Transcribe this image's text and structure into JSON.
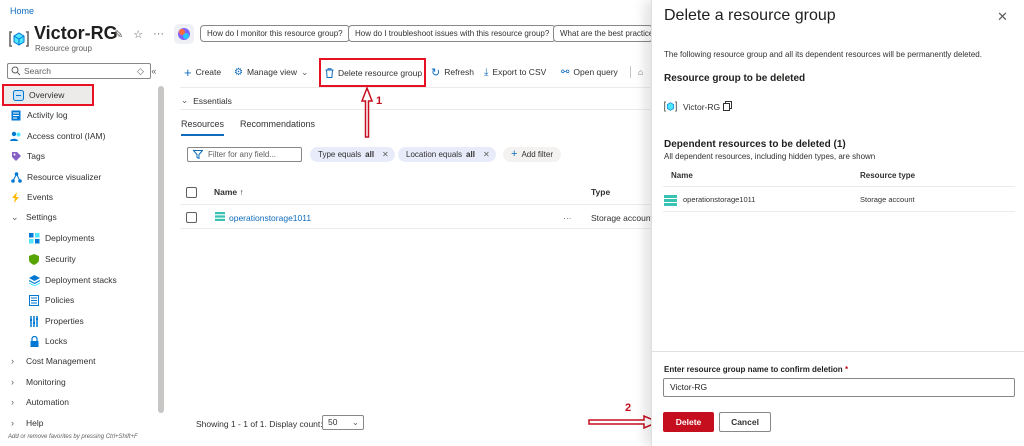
{
  "breadcrumb": "Home",
  "header": {
    "title": "Victor-RG",
    "subtitle": "Resource group",
    "suggestions": [
      "How do I monitor this resource group?",
      "How do I troubleshoot issues with this resource group?",
      "What are the best practices"
    ]
  },
  "nav": {
    "search_placeholder": "Search",
    "items": [
      {
        "label": "Overview"
      },
      {
        "label": "Activity log"
      },
      {
        "label": "Access control (IAM)"
      },
      {
        "label": "Tags"
      },
      {
        "label": "Resource visualizer"
      },
      {
        "label": "Events"
      },
      {
        "label": "Settings"
      },
      {
        "label": "Deployments"
      },
      {
        "label": "Security"
      },
      {
        "label": "Deployment stacks"
      },
      {
        "label": "Policies"
      },
      {
        "label": "Properties"
      },
      {
        "label": "Locks"
      },
      {
        "label": "Cost Management"
      },
      {
        "label": "Monitoring"
      },
      {
        "label": "Automation"
      },
      {
        "label": "Help"
      }
    ],
    "hint": "Add or remove favorites by pressing Ctrl+Shift+F"
  },
  "toolbar": {
    "create": "Create",
    "manage_view": "Manage view",
    "delete_rg": "Delete resource group",
    "refresh": "Refresh",
    "export_csv": "Export to CSV",
    "open_query": "Open query"
  },
  "essentials": "Essentials",
  "tabs": [
    "Resources",
    "Recommendations"
  ],
  "filters": {
    "placeholder": "Filter for any field...",
    "type_prefix": "Type equals",
    "type_value": "all",
    "loc_prefix": "Location equals",
    "loc_value": "all",
    "add_filter": "Add filter"
  },
  "table": {
    "col_name": "Name",
    "col_name_sort": "↑",
    "col_type": "Type",
    "rows": [
      {
        "name": "operationstorage1011",
        "more": "···",
        "type": "Storage account"
      }
    ]
  },
  "paging": {
    "text": "Showing 1 - 1 of 1. Display count:",
    "count": "50"
  },
  "annotations": {
    "one": "1",
    "two": "2"
  },
  "panel": {
    "title": "Delete a resource group",
    "close": "✕",
    "intro": "The following resource group and all its dependent resources will be permanently deleted.",
    "rg_heading": "Resource group to be deleted",
    "rg_name": "Victor-RG",
    "dep_heading": "Dependent resources to be deleted (1)",
    "dep_sub": "All dependent resources, including hidden types, are shown",
    "col_name": "Name",
    "col_type": "Resource type",
    "dep_rows": [
      {
        "name": "operationstorage1011",
        "type": "Storage account"
      }
    ],
    "confirm_label": "Enter resource group name to confirm deletion",
    "required_mark": "*",
    "confirm_value": "Victor-RG",
    "delete_btn": "Delete",
    "cancel_btn": "Cancel"
  },
  "colors": {
    "accent": "#0f6cbd",
    "danger": "#c50f1f",
    "highlight_red": "#e81123"
  }
}
